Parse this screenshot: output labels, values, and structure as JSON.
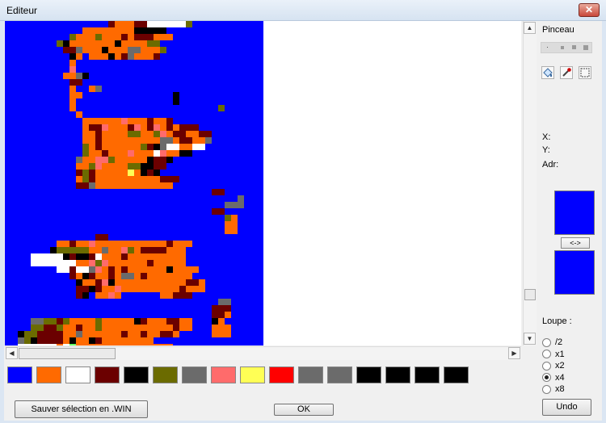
{
  "window": {
    "title": "Editeur",
    "close_glyph": "✕"
  },
  "palette": {
    "colors": [
      "#0000ff",
      "#ff6a00",
      "#ffffff",
      "#6b0000",
      "#000000",
      "#6b6b00",
      "#6b6b6b",
      "#ff6b6b",
      "#ffff55",
      "#ff0000",
      "#6b6b6b",
      "#6b6b6b",
      "#000000",
      "#000000",
      "#000000",
      "#000000"
    ]
  },
  "pixel_colors": {
    "B": "#0000ff",
    "O": "#ff6a00",
    "W": "#ffffff",
    "M": "#6b0000",
    "K": "#000000",
    "L": "#6b6b00",
    "G": "#6b6b6b",
    "P": "#ff6b6b",
    "Y": "#ffff55",
    "N": "#66ff66",
    "R": "#ff0000"
  },
  "side": {
    "pinceau_label": "Pinceau",
    "x_label": "X:",
    "y_label": "Y:",
    "adr_label": "Adr:",
    "swap_label": "<->",
    "loupe_label": "Loupe :",
    "zoom_options": [
      "/2",
      "x1",
      "x2",
      "x4",
      "x8"
    ],
    "zoom_selected": "x4",
    "undo_label": "Undo",
    "fg_color": "#0000ff",
    "bg_color": "#0000ff"
  },
  "buttons": {
    "save_label": "Sauver sélection en .WIN",
    "ok_label": "OK"
  },
  "icons": {
    "fill_tool": "fill-bucket-icon",
    "picker_tool": "eyedropper-icon",
    "select_tool": "selection-icon"
  }
}
